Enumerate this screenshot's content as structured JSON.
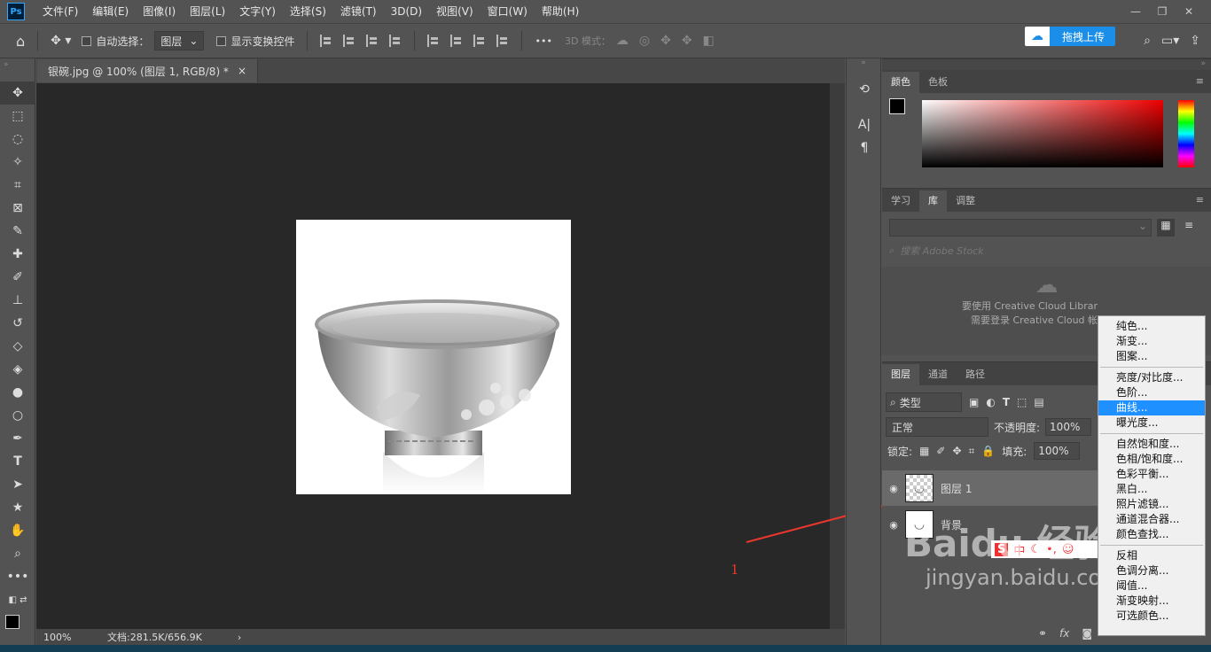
{
  "menu": [
    "文件(F)",
    "编辑(E)",
    "图像(I)",
    "图层(L)",
    "文字(Y)",
    "选择(S)",
    "滤镜(T)",
    "3D(D)",
    "视图(V)",
    "窗口(W)",
    "帮助(H)"
  ],
  "app_logo": "Ps",
  "options": {
    "auto_select_label": "自动选择：",
    "auto_select_value": "图层",
    "show_transform_label": "显示变换控件",
    "more": "•••",
    "mode_3d_label": "3D 模式："
  },
  "upload_label": "拖拽上传",
  "document": {
    "tab_title": "银碗.jpg @ 100% (图层 1, RGB/8) *",
    "zoom": "100%",
    "doc_info": "文档:281.5K/656.9K"
  },
  "color_panel": {
    "tabs": [
      "颜色",
      "色板"
    ]
  },
  "library_panel": {
    "tabs": [
      "学习",
      "库",
      "调整"
    ],
    "search_placeholder": "搜索 Adobe Stock",
    "msg1": "要使用 Creative Cloud Librar",
    "msg2": "需要登录 Creative Cloud 帐"
  },
  "layers_panel": {
    "tabs": [
      "图层",
      "通道",
      "路径"
    ],
    "kind_filter": "类型",
    "blend_mode": "正常",
    "opacity_label": "不透明度:",
    "opacity_value": "100%",
    "lock_label": "锁定:",
    "fill_label": "填充:",
    "fill_value": "100%",
    "layers": [
      {
        "name": "图层 1",
        "selected": true
      },
      {
        "name": "背景",
        "selected": false
      }
    ]
  },
  "context_menu": {
    "group1": [
      "纯色...",
      "渐变...",
      "图案..."
    ],
    "group2": [
      "亮度/对比度...",
      "色阶...",
      "曲线...",
      "曝光度..."
    ],
    "group3": [
      "自然饱和度...",
      "色相/饱和度...",
      "色彩平衡...",
      "黑白...",
      "照片滤镜...",
      "通道混合器...",
      "颜色查找..."
    ],
    "group4": [
      "反相",
      "色调分离...",
      "阈值...",
      "渐变映射...",
      "可选颜色..."
    ],
    "highlighted": "曲线..."
  },
  "annotation_number": "1",
  "ime": {
    "label": "中"
  },
  "watermark": {
    "brand": "Baidu 经验",
    "url": "jingyan.baidu.com"
  },
  "colors": {
    "accent": "#1e90ff",
    "ui_bg": "#535353",
    "canvas_bg": "#282828",
    "arrow": "#e8372c"
  }
}
